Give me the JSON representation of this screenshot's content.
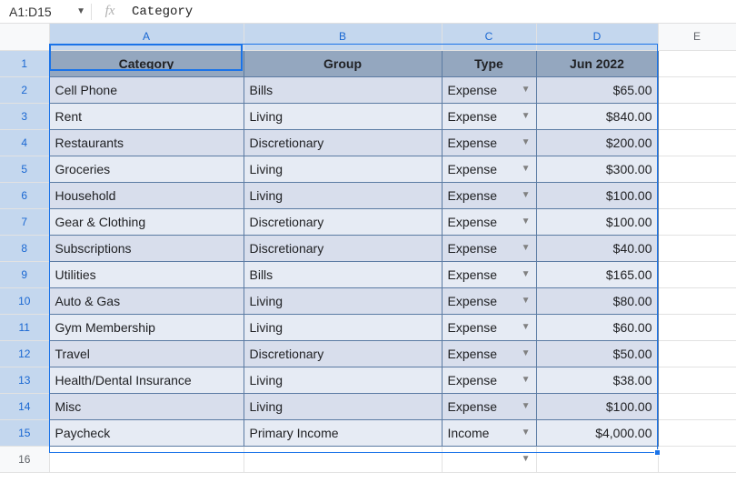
{
  "namebox": {
    "range": "A1:D15"
  },
  "fx_label": "fx",
  "formula_bar": {
    "value": "Category"
  },
  "columns": [
    "A",
    "B",
    "C",
    "D",
    "E"
  ],
  "selected_columns": [
    "A",
    "B",
    "C",
    "D"
  ],
  "row_count": 16,
  "selected_rows_max": 15,
  "headers": {
    "A": "Category",
    "B": "Group",
    "C": "Type",
    "D": "Jun 2022"
  },
  "chart_data": {
    "type": "table",
    "columns": [
      "Category",
      "Group",
      "Type",
      "Jun 2022"
    ],
    "rows": [
      {
        "Category": "Cell Phone",
        "Group": "Bills",
        "Type": "Expense",
        "Jun 2022": "$65.00"
      },
      {
        "Category": "Rent",
        "Group": "Living",
        "Type": "Expense",
        "Jun 2022": "$840.00"
      },
      {
        "Category": "Restaurants",
        "Group": "Discretionary",
        "Type": "Expense",
        "Jun 2022": "$200.00"
      },
      {
        "Category": "Groceries",
        "Group": "Living",
        "Type": "Expense",
        "Jun 2022": "$300.00"
      },
      {
        "Category": "Household",
        "Group": "Living",
        "Type": "Expense",
        "Jun 2022": "$100.00"
      },
      {
        "Category": "Gear & Clothing",
        "Group": "Discretionary",
        "Type": "Expense",
        "Jun 2022": "$100.00"
      },
      {
        "Category": "Subscriptions",
        "Group": "Discretionary",
        "Type": "Expense",
        "Jun 2022": "$40.00"
      },
      {
        "Category": "Utilities",
        "Group": "Bills",
        "Type": "Expense",
        "Jun 2022": "$165.00"
      },
      {
        "Category": "Auto & Gas",
        "Group": "Living",
        "Type": "Expense",
        "Jun 2022": "$80.00"
      },
      {
        "Category": "Gym Membership",
        "Group": "Living",
        "Type": "Expense",
        "Jun 2022": "$60.00"
      },
      {
        "Category": "Travel",
        "Group": "Discretionary",
        "Type": "Expense",
        "Jun 2022": "$50.00"
      },
      {
        "Category": "Health/Dental Insurance",
        "Group": "Living",
        "Type": "Expense",
        "Jun 2022": "$38.00"
      },
      {
        "Category": "Misc",
        "Group": "Living",
        "Type": "Expense",
        "Jun 2022": "$100.00"
      },
      {
        "Category": "Paycheck",
        "Group": "Primary Income",
        "Type": "Income",
        "Jun 2022": "$4,000.00"
      }
    ]
  }
}
